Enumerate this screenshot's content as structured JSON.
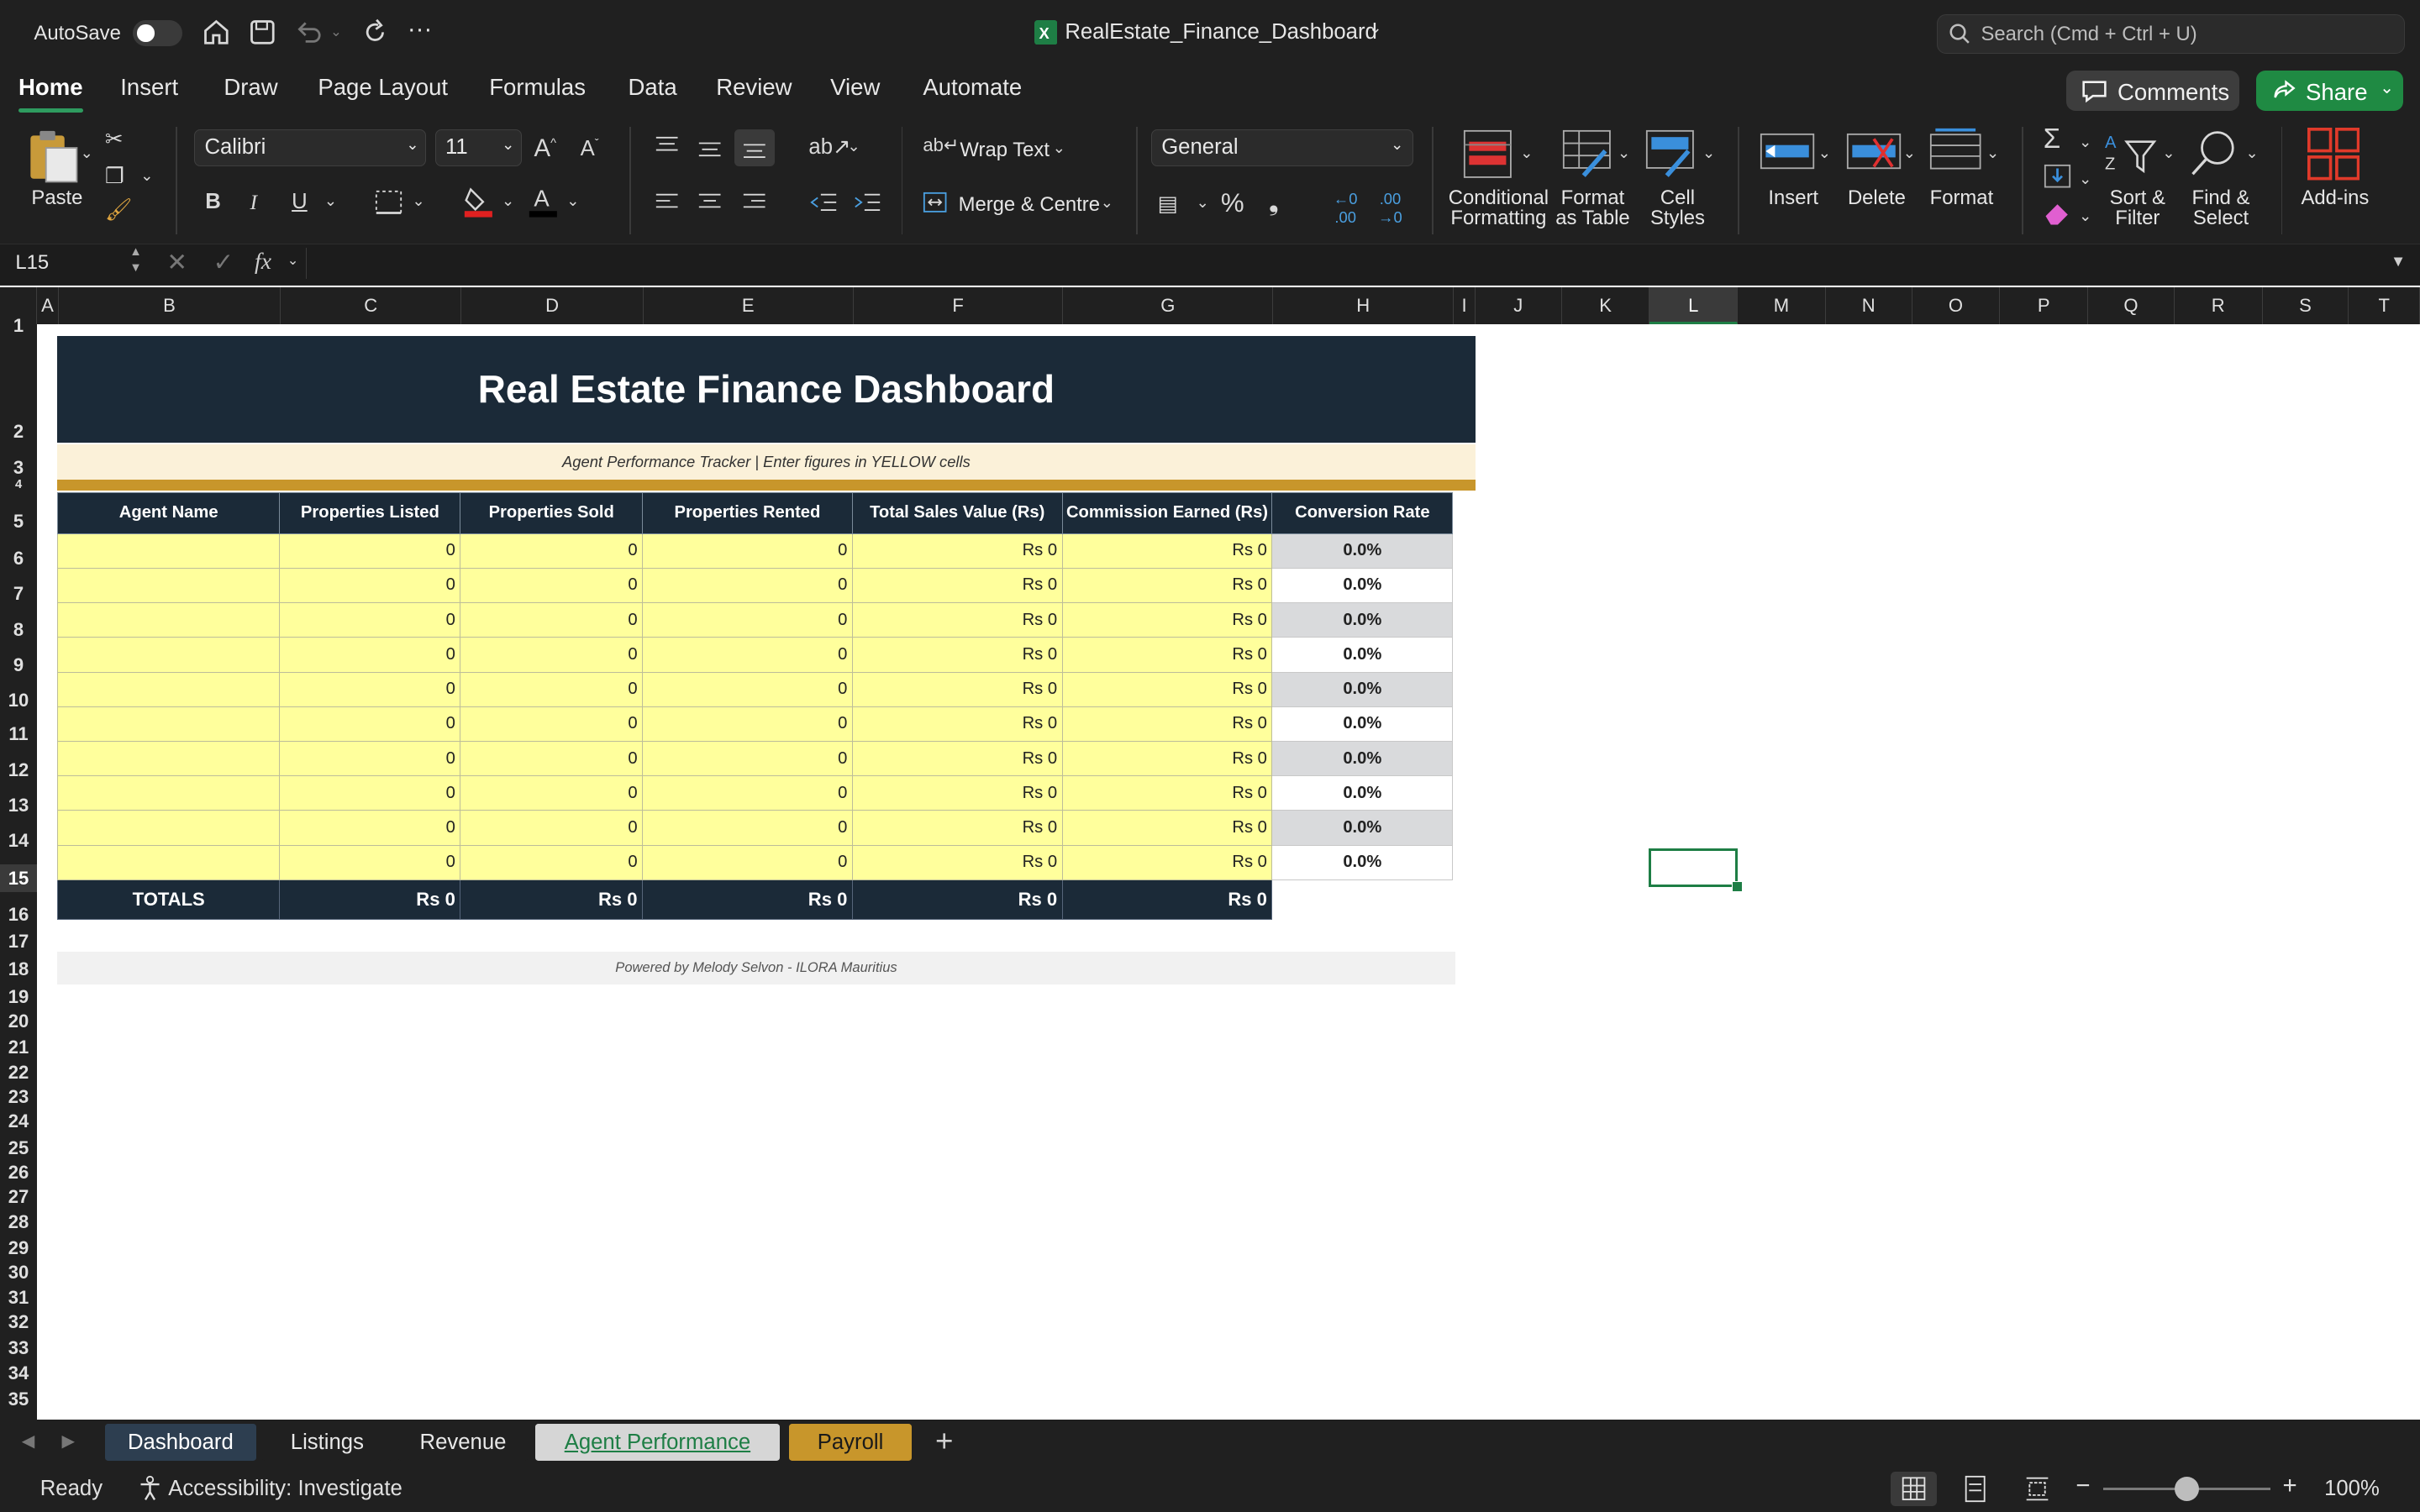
{
  "titlebar": {
    "autosave_label": "AutoSave",
    "doc_title": "RealEstate_Finance_Dashboard",
    "search_placeholder": "Search (Cmd + Ctrl + U)"
  },
  "tabs": [
    "Home",
    "Insert",
    "Draw",
    "Page Layout",
    "Formulas",
    "Data",
    "Review",
    "View",
    "Automate"
  ],
  "tab_buttons": {
    "comments": "Comments",
    "share": "Share"
  },
  "ribbon": {
    "paste": "Paste",
    "font_name": "Calibri",
    "font_size": "11",
    "wrap_text": "Wrap Text",
    "merge_centre": "Merge & Centre",
    "number_format": "General",
    "conditional_formatting": [
      "Conditional",
      "Formatting"
    ],
    "format_as_table": [
      "Format",
      "as Table"
    ],
    "cell_styles": [
      "Cell",
      "Styles"
    ],
    "insert": "Insert",
    "delete": "Delete",
    "format": "Format",
    "sort_filter": [
      "Sort &",
      "Filter"
    ],
    "find_select": [
      "Find &",
      "Select"
    ],
    "add_ins": "Add-ins"
  },
  "formula_bar": {
    "name_box": "L15",
    "fx": "fx",
    "formula": ""
  },
  "columns": [
    "A",
    "B",
    "C",
    "D",
    "E",
    "F",
    "G",
    "H",
    "I",
    "J",
    "K",
    "L",
    "M",
    "N",
    "O",
    "P",
    "Q",
    "R",
    "S",
    "T"
  ],
  "selected_column": "L",
  "rows": [
    "1",
    "2",
    "3",
    "4",
    "5",
    "6",
    "7",
    "8",
    "9",
    "10",
    "11",
    "12",
    "13",
    "14",
    "15",
    "16",
    "17",
    "18",
    "19",
    "20",
    "21",
    "22",
    "23",
    "24",
    "25",
    "26",
    "27",
    "28",
    "29",
    "30",
    "31",
    "32",
    "33",
    "34",
    "35"
  ],
  "selected_row": "15",
  "sheet": {
    "title": "Real Estate Finance Dashboard",
    "subtitle": "Agent Performance Tracker  |  Enter figures in YELLOW cells",
    "headers": [
      "Agent Name",
      "Properties Listed",
      "Properties Sold",
      "Properties Rented",
      "Total Sales Value (Rs)",
      "Commission Earned (Rs)",
      "Conversion Rate"
    ],
    "rows": [
      [
        "",
        "0",
        "0",
        "0",
        "Rs 0",
        "Rs 0",
        "0.0%"
      ],
      [
        "",
        "0",
        "0",
        "0",
        "Rs 0",
        "Rs 0",
        "0.0%"
      ],
      [
        "",
        "0",
        "0",
        "0",
        "Rs 0",
        "Rs 0",
        "0.0%"
      ],
      [
        "",
        "0",
        "0",
        "0",
        "Rs 0",
        "Rs 0",
        "0.0%"
      ],
      [
        "",
        "0",
        "0",
        "0",
        "Rs 0",
        "Rs 0",
        "0.0%"
      ],
      [
        "",
        "0",
        "0",
        "0",
        "Rs 0",
        "Rs 0",
        "0.0%"
      ],
      [
        "",
        "0",
        "0",
        "0",
        "Rs 0",
        "Rs 0",
        "0.0%"
      ],
      [
        "",
        "0",
        "0",
        "0",
        "Rs 0",
        "Rs 0",
        "0.0%"
      ],
      [
        "",
        "0",
        "0",
        "0",
        "Rs 0",
        "Rs 0",
        "0.0%"
      ],
      [
        "",
        "0",
        "0",
        "0",
        "Rs 0",
        "Rs 0",
        "0.0%"
      ]
    ],
    "totals": [
      "TOTALS",
      "Rs 0",
      "Rs 0",
      "Rs 0",
      "Rs 0",
      "Rs 0"
    ],
    "footer": "Powered by Melody Selvon  -  ILORA Mauritius"
  },
  "sheet_tabs": [
    {
      "label": "Dashboard",
      "bg": "#2d3e50",
      "fg": "#ffffff"
    },
    {
      "label": "Listings",
      "bg": "#202020",
      "fg": "#e8e8e8"
    },
    {
      "label": "Revenue",
      "bg": "#202020",
      "fg": "#e8e8e8"
    },
    {
      "label": "Agent Performance",
      "bg": "#d6d6d6",
      "fg": "#1e7e45"
    },
    {
      "label": "Payroll",
      "bg": "#c8962b",
      "fg": "#1a1a1a"
    }
  ],
  "active_sheet": "Agent Performance",
  "status": {
    "ready": "Ready",
    "accessibility": "Accessibility: Investigate",
    "zoom": "100%"
  },
  "colors": {
    "header_navy": "#1b2a38",
    "gold": "#c8962b",
    "input_yellow": "#ffff9c",
    "accent_green": "#1e7e45"
  }
}
